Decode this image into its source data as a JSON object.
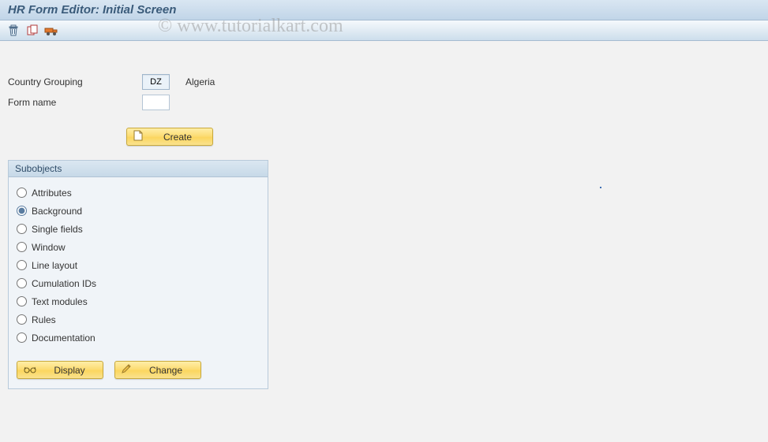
{
  "header": {
    "title": "HR Form Editor: Initial Screen"
  },
  "watermark": "© www.tutorialkart.com",
  "form": {
    "country_label": "Country Grouping",
    "country_code": "DZ",
    "country_name": "Algeria",
    "form_name_label": "Form name",
    "form_name_value": ""
  },
  "buttons": {
    "create": "Create",
    "display": "Display",
    "change": "Change"
  },
  "subobjects": {
    "title": "Subobjects",
    "items": [
      {
        "label": "Attributes"
      },
      {
        "label": "Background"
      },
      {
        "label": "Single fields"
      },
      {
        "label": "Window"
      },
      {
        "label": "Line layout"
      },
      {
        "label": "Cumulation IDs"
      },
      {
        "label": "Text modules"
      },
      {
        "label": "Rules"
      },
      {
        "label": "Documentation"
      }
    ],
    "selected_index": 1
  }
}
